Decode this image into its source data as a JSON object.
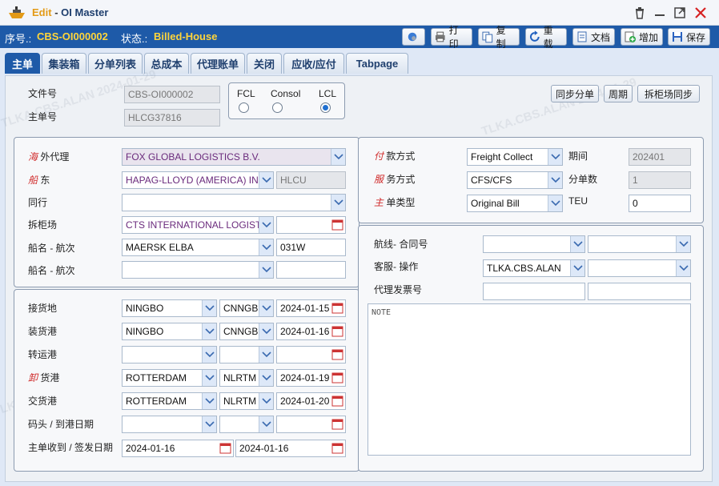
{
  "window": {
    "mode": "Edit",
    "separator": "-",
    "title": "OI Master"
  },
  "info": {
    "serial_label": "序号.:",
    "serial_value": "CBS-OI000002",
    "status_label": "状态.:",
    "status_value": "Billed-House"
  },
  "toolbar": {
    "print": "打印",
    "copy": "复制",
    "reload": "重载",
    "docs": "文档",
    "add": "增加",
    "save": "保存"
  },
  "tabs": [
    "主单",
    "集装箱",
    "分单列表",
    "总成本",
    "代理账单",
    "关闭",
    "应收/应付",
    "Tabpage"
  ],
  "header": {
    "file_no_label": "文件号",
    "file_no": "CBS-OI000002",
    "master_no_label": "主单号",
    "master_no": "HLCG37816",
    "load_types": [
      "FCL",
      "Consol",
      "LCL"
    ],
    "sync_house": "同步分单",
    "period_btn": "周期",
    "sync_devanning": "拆柜场同步"
  },
  "party": {
    "overseas_agent_mark": "海",
    "overseas_agent_rest": " 外代理",
    "overseas_agent": "FOX GLOBAL LOGISTICS B.V.",
    "carrier_mark": "船",
    "carrier_rest": " 东",
    "carrier": "HAPAG-LLOYD (AMERICA) INC.",
    "carrier_code": "HLCU",
    "coloader_label": "同行",
    "coloader": "",
    "devanning_label": "拆柜场",
    "devanning": "CTS INTERNATIONAL LOGISTICS",
    "devanning_date": "",
    "vessel_label": "船名 - 航次",
    "vessel": "MAERSK ELBA",
    "voyage": "031W",
    "vessel2_label": "船名 - 航次",
    "vessel2": "",
    "voyage2": ""
  },
  "routing": {
    "receipt_label": "接货地",
    "receipt": "NINGBO",
    "receipt_code": "CNNGB",
    "receipt_date": "2024-01-15",
    "loading_label": "装货港",
    "loading": "NINGBO",
    "loading_code": "CNNGB",
    "loading_date": "2024-01-16",
    "transship_label": "转运港",
    "discharge_mark": "卸",
    "discharge_rest": " 货港",
    "discharge": "ROTTERDAM",
    "discharge_code": "NLRTM",
    "discharge_date": "2024-01-19",
    "delivery_label": "交货港",
    "delivery": "ROTTERDAM",
    "delivery_code": "NLRTM",
    "delivery_date": "2024-01-20",
    "pier_label": "码头 / 到港日期",
    "received_label": "主单收到 / 签发日期",
    "received_date": "2024-01-16",
    "issued_date": "2024-01-16"
  },
  "terms": {
    "payment_mark": "付",
    "payment_rest": " 款方式",
    "payment": "Freight Collect",
    "service_mark": "服",
    "service_rest": " 务方式",
    "service": "CFS/CFS",
    "bl_type_mark": "主",
    "bl_type_rest": " 单类型",
    "bl_type": "Original Bill",
    "period_label": "期间",
    "period": "202401",
    "house_count_label": "分单数",
    "house_count": "1",
    "teu_label": "TEU",
    "teu": "0"
  },
  "contract": {
    "route_label": "航线- 合同号",
    "cs_label": "客服- 操作",
    "cs": "TLKA.CBS.ALAN",
    "invoice_label": "代理发票号",
    "note": "NOTE"
  },
  "watermark": "TLKA.CBS.ALAN 2024-01-29"
}
